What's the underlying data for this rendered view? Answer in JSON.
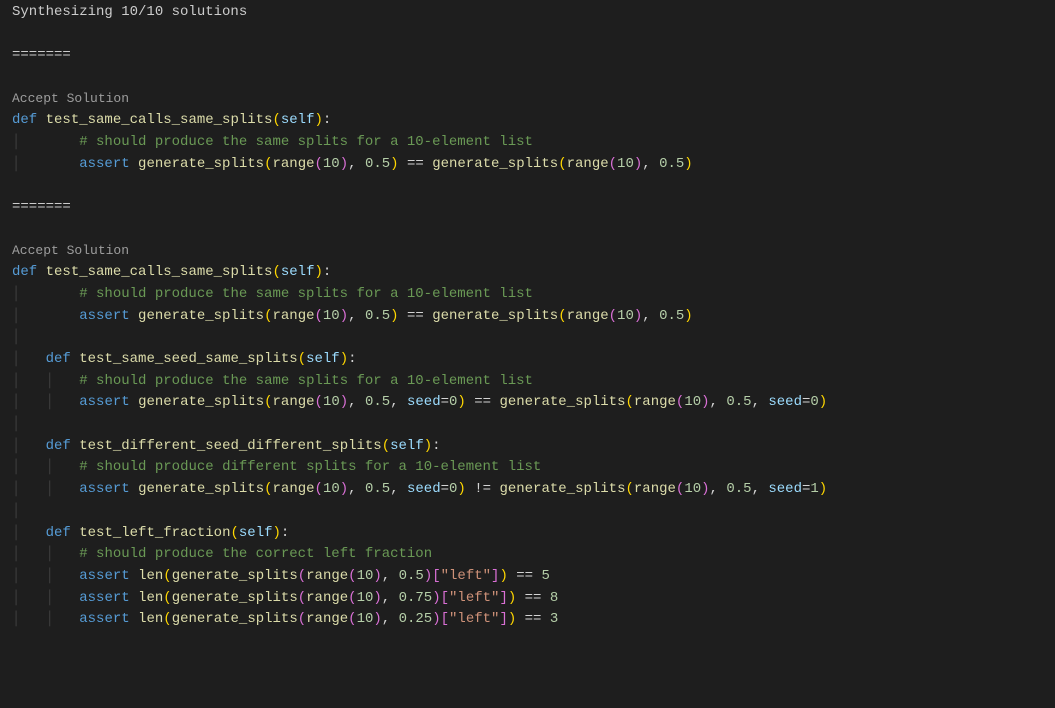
{
  "status": "Synthesizing 10/10 solutions",
  "separator": "=======",
  "accept_label": "Accept Solution",
  "solutions": [
    {
      "functions": [
        {
          "name": "test_same_calls_same_splits",
          "comment": "# should produce the same splits for a 10-element list",
          "asserts": [
            {
              "lhs_fn": "generate_splits",
              "lhs_args": "range(10), 0.5",
              "op": "==",
              "rhs_fn": "generate_splits",
              "rhs_args": "range(10), 0.5"
            }
          ]
        }
      ]
    },
    {
      "functions": [
        {
          "name": "test_same_calls_same_splits",
          "comment": "# should produce the same splits for a 10-element list",
          "asserts": [
            {
              "lhs_fn": "generate_splits",
              "lhs_args": "range(10), 0.5",
              "op": "==",
              "rhs_fn": "generate_splits",
              "rhs_args": "range(10), 0.5"
            }
          ]
        },
        {
          "name": "test_same_seed_same_splits",
          "comment": "# should produce the same splits for a 10-element list",
          "asserts": [
            {
              "lhs_fn": "generate_splits",
              "lhs_args": "range(10), 0.5, seed=0",
              "op": "==",
              "rhs_fn": "generate_splits",
              "rhs_args": "range(10), 0.5, seed=0"
            }
          ]
        },
        {
          "name": "test_different_seed_different_splits",
          "comment": "# should produce different splits for a 10-element list",
          "asserts": [
            {
              "lhs_fn": "generate_splits",
              "lhs_args": "range(10), 0.5, seed=0",
              "op": "!=",
              "rhs_fn": "generate_splits",
              "rhs_args": "range(10), 0.5, seed=1"
            }
          ]
        },
        {
          "name": "test_left_fraction",
          "comment": "# should produce the correct left fraction",
          "len_asserts": [
            {
              "args": "range(10), 0.5",
              "key": "\"left\"",
              "op": "==",
              "val": "5"
            },
            {
              "args": "range(10), 0.75",
              "key": "\"left\"",
              "op": "==",
              "val": "8"
            },
            {
              "args": "range(10), 0.25",
              "key": "\"left\"",
              "op": "==",
              "val": "3"
            }
          ]
        }
      ]
    }
  ]
}
